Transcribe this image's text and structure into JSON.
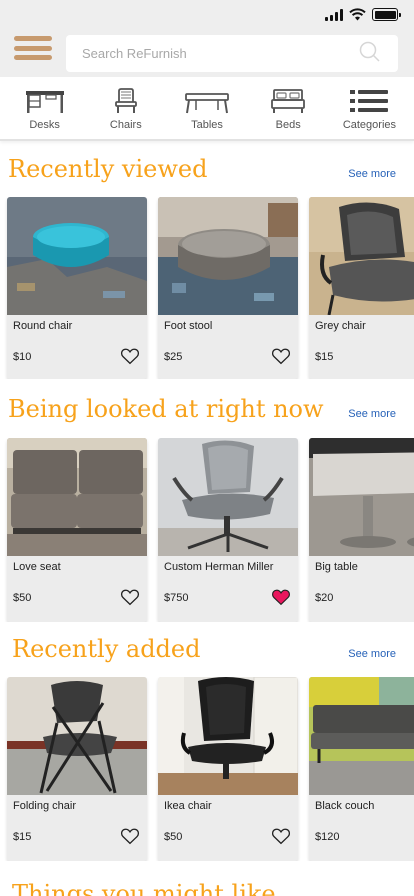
{
  "search": {
    "placeholder": "Search ReFurnish"
  },
  "categories": [
    {
      "label": "Desks",
      "icon": "desk-icon"
    },
    {
      "label": "Chairs",
      "icon": "chair-icon"
    },
    {
      "label": "Tables",
      "icon": "table-icon"
    },
    {
      "label": "Beds",
      "icon": "bed-icon"
    },
    {
      "label": "Categories",
      "icon": "list-icon"
    }
  ],
  "sections": [
    {
      "title": "Recently viewed",
      "see_more": "See more",
      "items": [
        {
          "name": "Round chair",
          "price": "$10",
          "favorited": false
        },
        {
          "name": "Foot stool",
          "price": "$25",
          "favorited": false
        },
        {
          "name": "Grey chair",
          "price": "$15",
          "favorited": false
        }
      ]
    },
    {
      "title": "Being looked at right now",
      "see_more": "See more",
      "items": [
        {
          "name": "Love seat",
          "price": "$50",
          "favorited": false
        },
        {
          "name": "Custom Herman Miller",
          "price": "$750",
          "favorited": true
        },
        {
          "name": "Big table",
          "price": "$20",
          "favorited": false
        }
      ]
    },
    {
      "title": "Recently added",
      "see_more": "See more",
      "items": [
        {
          "name": "Folding chair",
          "price": "$15",
          "favorited": false
        },
        {
          "name": "Ikea chair",
          "price": "$50",
          "favorited": false
        },
        {
          "name": "Black couch",
          "price": "$120",
          "favorited": false
        }
      ]
    }
  ],
  "next_section_title": "Things you might like",
  "colors": {
    "accent": "#f7a21b",
    "link": "#2762b8",
    "heart_active": "#e8175d",
    "menu": "#c79a6e"
  }
}
